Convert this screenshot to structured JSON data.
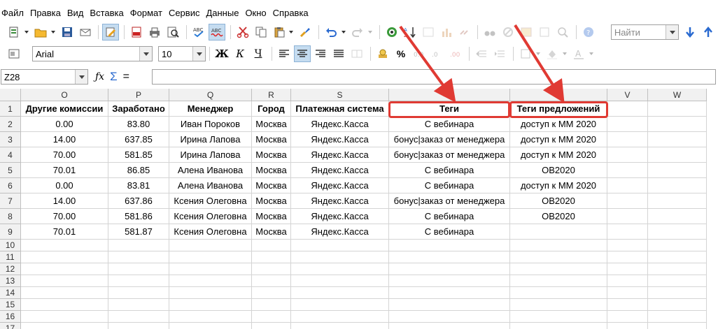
{
  "menu": [
    "Файл",
    "Правка",
    "Вид",
    "Вставка",
    "Формат",
    "Сервис",
    "Данные",
    "Окно",
    "Справка"
  ],
  "toolbar": {
    "find_placeholder": "Найти",
    "font_name": "Arial",
    "font_size": "10",
    "bold_label": "Ж",
    "italic_label": "К",
    "underline_label": "Ч",
    "percent_label": "%"
  },
  "formula_bar": {
    "name_box": "Z28",
    "sum_label": "Σ",
    "equals_label": "=",
    "content": ""
  },
  "columns": [
    "O",
    "P",
    "Q",
    "R",
    "S",
    "",
    "",
    "V",
    "W"
  ],
  "rows": [
    {
      "n": "1",
      "cells": [
        "Другие комиссии",
        "Заработано",
        "Менеджер",
        "Город",
        "Платежная система",
        "Теги",
        "Теги предложений",
        "",
        ""
      ]
    },
    {
      "n": "2",
      "cells": [
        "0.00",
        "83.80",
        "Иван Пороков",
        "Москва",
        "Яндекс.Касса",
        "С вебинара",
        "доступ к ММ 2020",
        "",
        ""
      ]
    },
    {
      "n": "3",
      "cells": [
        "14.00",
        "637.85",
        "Ирина Лапова",
        "Москва",
        "Яндекс.Касса",
        "бонус|заказ от менеджера",
        "доступ к ММ 2020",
        "",
        ""
      ]
    },
    {
      "n": "4",
      "cells": [
        "70.00",
        "581.85",
        "Ирина Лапова",
        "Москва",
        "Яндекс.Касса",
        "бонус|заказ от менеджера",
        "доступ к ММ 2020",
        "",
        ""
      ]
    },
    {
      "n": "5",
      "cells": [
        "70.01",
        "86.85",
        "Алена Иванова",
        "Москва",
        "Яндекс.Касса",
        "С вебинара",
        "OB2020",
        "",
        ""
      ]
    },
    {
      "n": "6",
      "cells": [
        "0.00",
        "83.81",
        "Алена Иванова",
        "Москва",
        "Яндекс.Касса",
        "С вебинара",
        "доступ к ММ 2020",
        "",
        ""
      ]
    },
    {
      "n": "7",
      "cells": [
        "14.00",
        "637.86",
        "Ксения Олеговна",
        "Москва",
        "Яндекс.Касса",
        "бонус|заказ от менеджера",
        "OB2020",
        "",
        ""
      ]
    },
    {
      "n": "8",
      "cells": [
        "70.00",
        "581.86",
        "Ксения Олеговна",
        "Москва",
        "Яндекс.Касса",
        "С вебинара",
        "OB2020",
        "",
        ""
      ]
    },
    {
      "n": "9",
      "cells": [
        "70.01",
        "581.87",
        "Ксения Олеговна",
        "Москва",
        "Яндекс.Касса",
        "С вебинара",
        "",
        "",
        ""
      ]
    },
    {
      "n": "10",
      "cells": [
        "",
        "",
        "",
        "",
        "",
        "",
        "",
        "",
        ""
      ]
    },
    {
      "n": "11",
      "cells": [
        "",
        "",
        "",
        "",
        "",
        "",
        "",
        "",
        ""
      ]
    },
    {
      "n": "12",
      "cells": [
        "",
        "",
        "",
        "",
        "",
        "",
        "",
        "",
        ""
      ]
    },
    {
      "n": "13",
      "cells": [
        "",
        "",
        "",
        "",
        "",
        "",
        "",
        "",
        ""
      ]
    },
    {
      "n": "14",
      "cells": [
        "",
        "",
        "",
        "",
        "",
        "",
        "",
        "",
        ""
      ]
    },
    {
      "n": "15",
      "cells": [
        "",
        "",
        "",
        "",
        "",
        "",
        "",
        "",
        ""
      ]
    },
    {
      "n": "16",
      "cells": [
        "",
        "",
        "",
        "",
        "",
        "",
        "",
        "",
        ""
      ]
    },
    {
      "n": "17",
      "cells": [
        "",
        "",
        "",
        "",
        "",
        "",
        "",
        "",
        ""
      ]
    }
  ],
  "colors": {
    "annotation": "#e03a33",
    "header_bg": "#f1f1f1",
    "active_tool": "#c5dcf0"
  },
  "icons": [
    "paste-icon",
    "open-icon",
    "save-icon",
    "email-icon",
    "edit-mode-icon",
    "pdf-icon",
    "print-icon",
    "print-preview-icon",
    "spellcheck-icon",
    "autospell-icon",
    "cut-icon",
    "copy-icon",
    "clipboard-icon",
    "format-paintbrush-icon",
    "undo-icon",
    "redo-icon",
    "navigator-icon",
    "sort-icon",
    "find-down-icon",
    "find-up-icon"
  ]
}
